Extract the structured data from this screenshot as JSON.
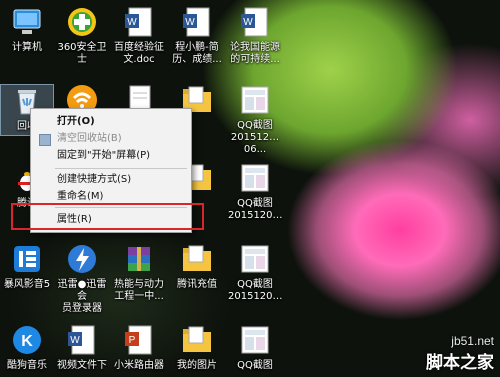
{
  "desktop_icons": {
    "computer": "计算机",
    "security": "360安全卫士",
    "doc_baidu": "百度经验征\n文.doc",
    "doc_cheng": "程小鹏-简\n历、成绩...",
    "doc_lun": "论我国能源\n的可持续...",
    "recycle": "回收",
    "qq1": "QQ截图\n201512…06...",
    "qq2": "QQ截图\n2015120…",
    "qq_tencent": "腾讯",
    "qq3": "QQ截图\n2015120…",
    "baofeng": "暴风影音5",
    "xunlei": "迅雷●迅雷会\n员登录器",
    "rigin": "热能与动力\n工程一中...",
    "tengxun_charge": "腾讯充值",
    "qq4": "QQ截图\n2015120…",
    "kugou": "酷狗音乐",
    "video_file": "视频文件下",
    "xiaomi": "小米路由器",
    "mypic": "我的图片",
    "qq5": "QQ截图"
  },
  "context_menu": {
    "open": "打开(O)",
    "empty_recycle": "清空回收站(B)",
    "pin_start": "固定到\"开始\"屏幕(P)",
    "create_shortcut": "创建快捷方式(S)",
    "rename": "重命名(M)",
    "properties": "属性(R)"
  },
  "watermark": {
    "url": "jb51.net",
    "brand": "脚本之家"
  },
  "colors": {
    "highlight_box": "#d8262a",
    "menu_bg": "#f2f2f2"
  }
}
